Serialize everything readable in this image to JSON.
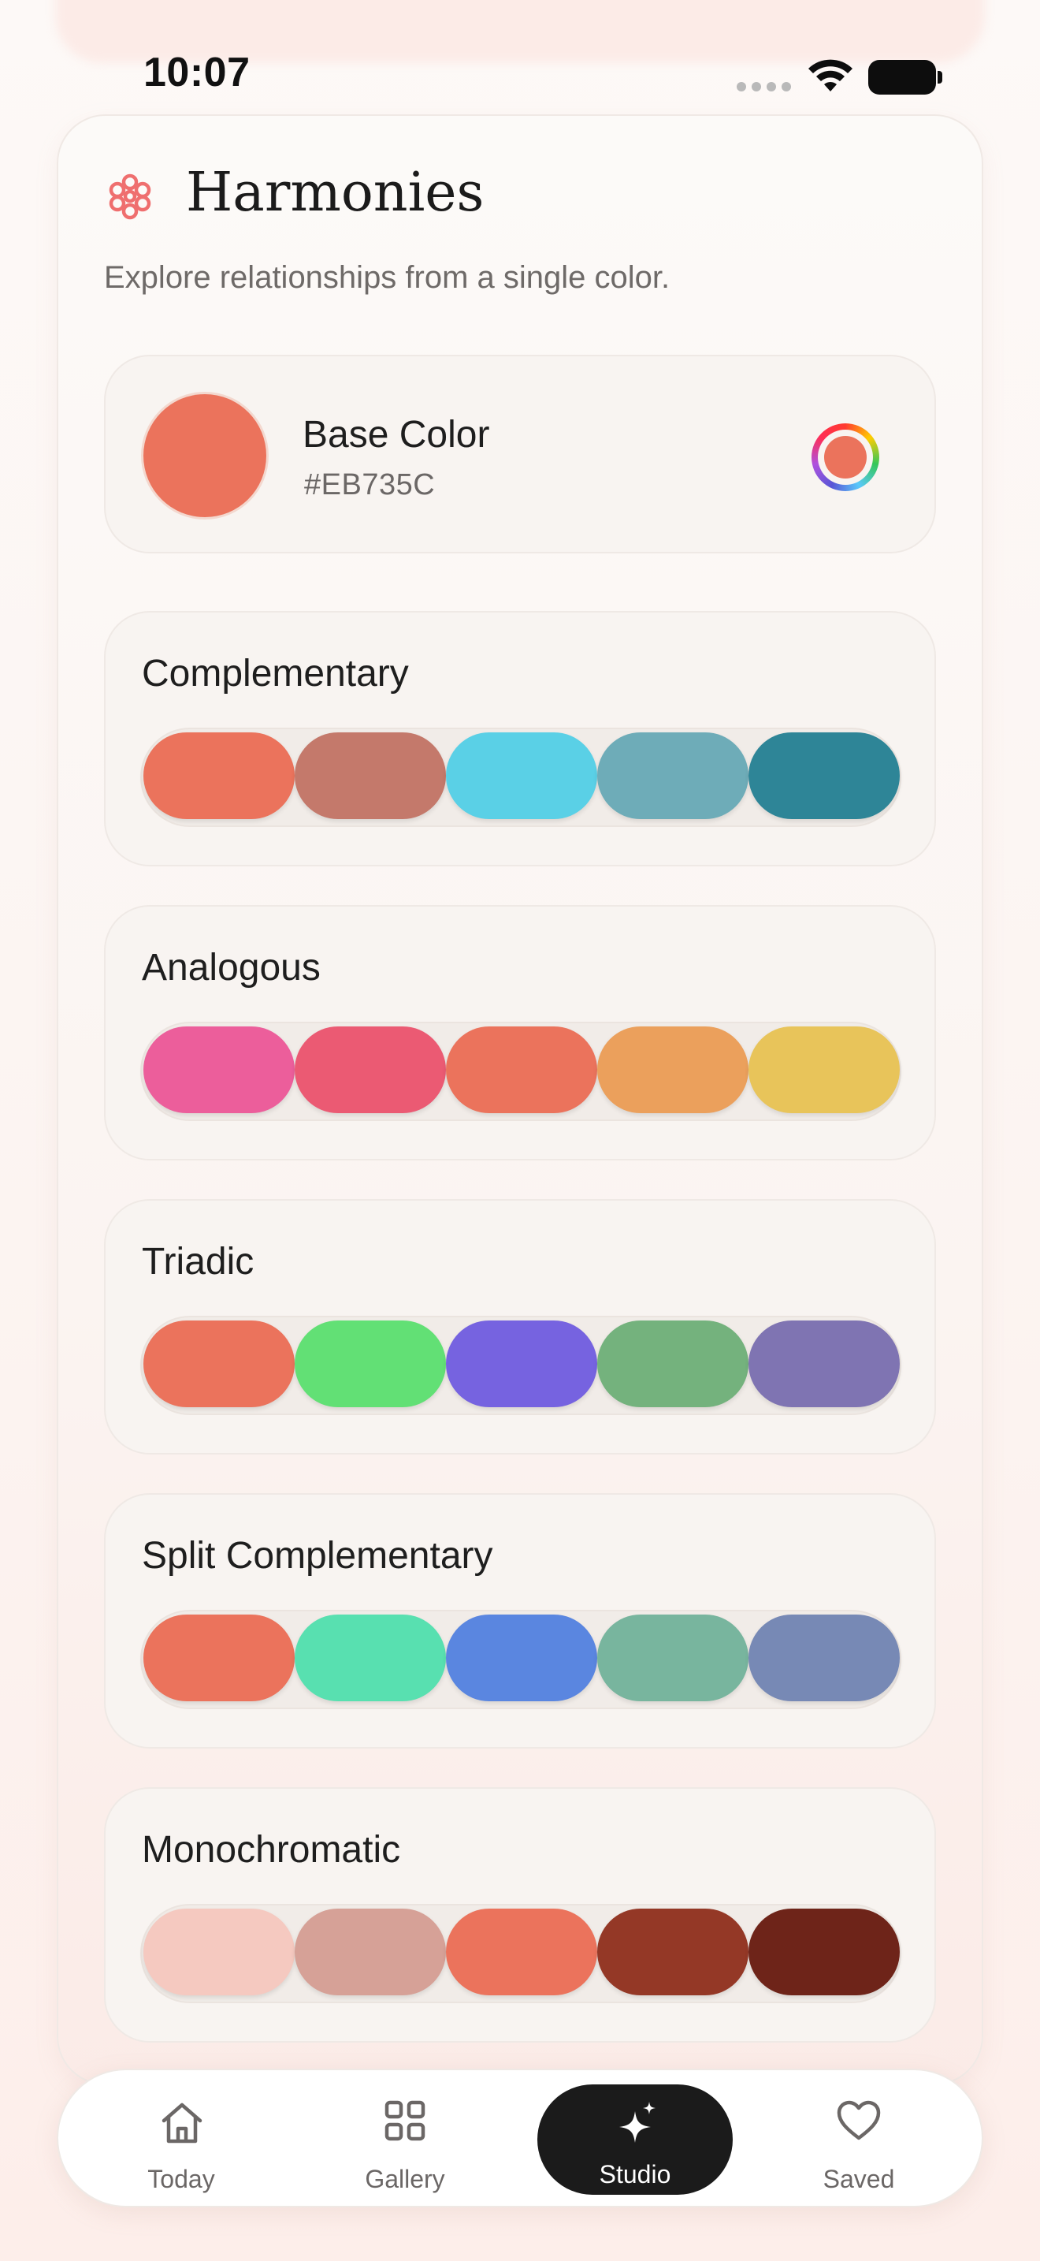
{
  "status_bar": {
    "time": "10:07"
  },
  "header": {
    "title": "Harmonies",
    "subtitle": "Explore relationships from a single color."
  },
  "base_color": {
    "label": "Base Color",
    "hex": "#EB735C",
    "color": "#eb735c"
  },
  "harmonies": [
    {
      "name": "Complementary",
      "swatches": [
        "#eb735c",
        "#c4796b",
        "#5ad0e6",
        "#6eacb8",
        "#2e8597"
      ]
    },
    {
      "name": "Analogous",
      "swatches": [
        "#ec5e9b",
        "#eb5a73",
        "#eb735c",
        "#eba05c",
        "#e8c45a"
      ]
    },
    {
      "name": "Triadic",
      "swatches": [
        "#eb735c",
        "#62e075",
        "#7663e0",
        "#74b27d",
        "#7f74b2"
      ]
    },
    {
      "name": "Split Complementary",
      "swatches": [
        "#eb735c",
        "#58e0b0",
        "#5a86e0",
        "#78b59e",
        "#7789b5"
      ]
    },
    {
      "name": "Monochromatic",
      "swatches": [
        "#f5c9c0",
        "#d6a197",
        "#eb735c",
        "#943826",
        "#6e2419"
      ]
    }
  ],
  "tabbar": {
    "items": [
      {
        "label": "Today",
        "icon": "home-icon"
      },
      {
        "label": "Gallery",
        "icon": "grid-icon"
      },
      {
        "label": "Studio",
        "icon": "sparkle-icon",
        "active": true
      },
      {
        "label": "Saved",
        "icon": "heart-icon"
      }
    ]
  }
}
